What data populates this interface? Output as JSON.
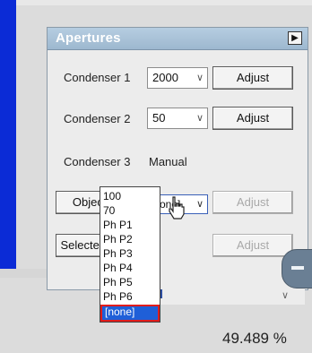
{
  "panel": {
    "title": "Apertures",
    "collapse_arrow": "▶"
  },
  "condenser1": {
    "label": "Condenser 1",
    "value": "2000",
    "adjust_label": "Adjust"
  },
  "condenser2": {
    "label": "Condenser 2",
    "value": "50",
    "adjust_label": "Adjust"
  },
  "condenser3": {
    "label": "Condenser 3",
    "value": "Manual"
  },
  "objective": {
    "button_label": "Objective",
    "value": "[none]",
    "adjust_label": "Adjust",
    "options": [
      "100",
      "70",
      "Ph P1",
      "Ph P2",
      "Ph P3",
      "Ph P4",
      "Ph P5",
      "Ph P6",
      "[none]"
    ],
    "selected": "[none]"
  },
  "selected_area": {
    "button_label": "Selected Area",
    "adjust_label": "Adjust"
  },
  "readout": {
    "value": "49.489 %"
  },
  "icons": {
    "chevron": "∨",
    "cursor": "hand-pointer-icon"
  },
  "colors": {
    "header": "#9db8cf",
    "selection": "#1f5fd8",
    "highlight_outline": "#e11c1c",
    "app_blue": "#0b2bd6"
  }
}
